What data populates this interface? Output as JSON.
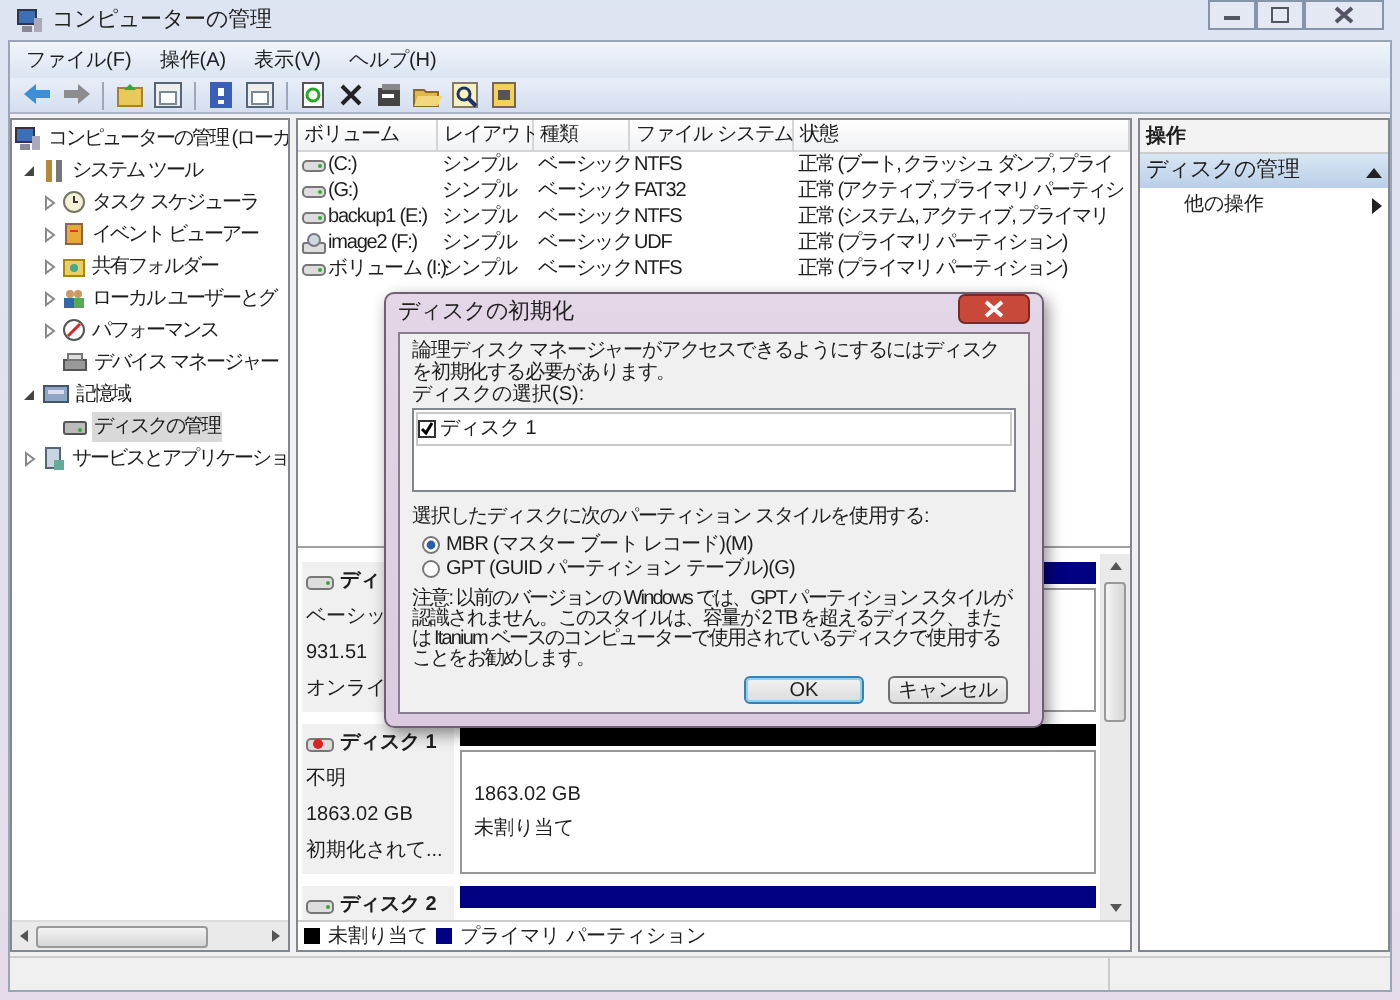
{
  "window": {
    "title": "コンピューターの管理"
  },
  "menu": [
    {
      "label": "ファイル(F)"
    },
    {
      "label": "操作(A)"
    },
    {
      "label": "表示(V)"
    },
    {
      "label": "ヘルプ(H)"
    }
  ],
  "tree": [
    {
      "label": "コンピューターの管理 (ローカ",
      "selected": false,
      "children": [
        {
          "label": "システム ツール",
          "expanded": true,
          "selected": false,
          "children": [
            {
              "label": "タスク スケジューラ",
              "expanded": false,
              "selected": false
            },
            {
              "label": "イベント ビューアー",
              "expanded": false,
              "selected": false
            },
            {
              "label": "共有フォルダー",
              "expanded": false,
              "selected": false
            },
            {
              "label": "ローカル ユーザーとグ",
              "expanded": false,
              "selected": false
            },
            {
              "label": "パフォーマンス",
              "expanded": false,
              "selected": false
            },
            {
              "label": "デバイス マネージャー",
              "selected": false
            }
          ]
        },
        {
          "label": "記憶域",
          "expanded": true,
          "selected": false,
          "children": [
            {
              "label": "ディスクの管理",
              "selected": true
            }
          ]
        },
        {
          "label": "サービスとアプリケーショ",
          "expanded": false,
          "selected": false
        }
      ]
    }
  ],
  "volumes": {
    "columns": [
      "ボリューム",
      "レイアウト",
      "種類",
      "ファイル システム",
      "状態"
    ],
    "rows": [
      {
        "kind": "drive",
        "cells": [
          "(C:)",
          "シンプル",
          "ベーシック",
          "NTFS",
          "正常 (ブート, クラッシュ ダンプ, プライ"
        ]
      },
      {
        "kind": "drive",
        "cells": [
          "(G:)",
          "シンプル",
          "ベーシック",
          "FAT32",
          "正常 (アクティブ, プライマリ パーティシ"
        ]
      },
      {
        "kind": "drive",
        "cells": [
          "backup1 (E:)",
          "シンプル",
          "ベーシック",
          "NTFS",
          "正常 (システム, アクティブ, プライマリ"
        ]
      },
      {
        "kind": "optical",
        "cells": [
          "image2 (F:)",
          "シンプル",
          "ベーシック",
          "UDF",
          "正常 (プライマリ パーティション)"
        ]
      },
      {
        "kind": "drive",
        "cells": [
          "ボリューム (I:)",
          "シンプル",
          "ベーシック",
          "NTFS",
          "正常 (プライマリ パーティション)"
        ]
      }
    ]
  },
  "disks": [
    {
      "kind": "basic",
      "name": "ディ",
      "details": [
        "ベーシッ",
        "931.51",
        "オンライ"
      ],
      "color": "#000080"
    },
    {
      "kind": "unknown",
      "name": "ディスク 1",
      "details": [
        "不明",
        "1863.02 GB",
        "初期化されて..."
      ],
      "color": "#000000",
      "partition": {
        "size": "1863.02 GB",
        "label": "未割り当て"
      }
    },
    {
      "kind": "basic",
      "name": "ディスク 2",
      "color": "#000080"
    }
  ],
  "legend": [
    {
      "label": "未割り当て",
      "color": "#000000"
    },
    {
      "label": "プライマリ パーティション",
      "color": "#000080"
    }
  ],
  "actions": {
    "header": "操作",
    "section": {
      "title": "ディスクの管理",
      "expanded": true
    },
    "items": [
      {
        "label": "他の操作"
      }
    ]
  },
  "dialog": {
    "title": "ディスクの初期化",
    "message": "論理ディスク マネージャーがアクセスできるようにするにはディスクを初期化する必要があります。",
    "disk_label": "ディスクの選択(S):",
    "disks": [
      {
        "label": "ディスク 1",
        "checked": true
      }
    ],
    "style_label": "選択したディスクに次のパーティション スタイルを使用する:",
    "styles": [
      {
        "label": "MBR (マスター ブート レコード)(M)",
        "selected": true
      },
      {
        "label": "GPT (GUID パーティション テーブル)(G)",
        "selected": false
      }
    ],
    "note": "注意: 以前のバージョンの Windows では、GPT パーティション スタイルが認識されません。このスタイルは、容量が 2 TB を超えるディスク、または Itanium ベースのコンピューターで使用されているディスクで使用することをお勧めします。",
    "buttons": [
      {
        "label": "OK",
        "default": true
      },
      {
        "label": "キャンセル",
        "default": false
      }
    ]
  }
}
